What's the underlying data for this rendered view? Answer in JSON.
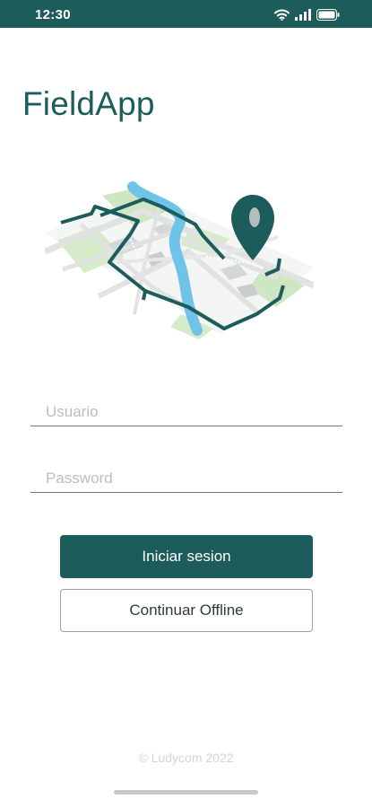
{
  "status_bar": {
    "time": "12:30",
    "icons": [
      "wifi-icon",
      "signal-icon",
      "battery-icon"
    ]
  },
  "app": {
    "title": "FieldApp"
  },
  "illustration": {
    "icon": "map-pin-illustration"
  },
  "login": {
    "username_placeholder": "Usuario",
    "username_value": "",
    "password_placeholder": "Password",
    "password_value": "",
    "login_button": "Iniciar sesion",
    "offline_button": "Continuar Offline"
  },
  "footer": {
    "copyright": "© Ludycom 2022"
  },
  "colors": {
    "primary": "#1c5c5a",
    "map_green": "#cfe6c2",
    "map_water": "#6fc3e8",
    "map_roads": "#e1e3e3"
  }
}
